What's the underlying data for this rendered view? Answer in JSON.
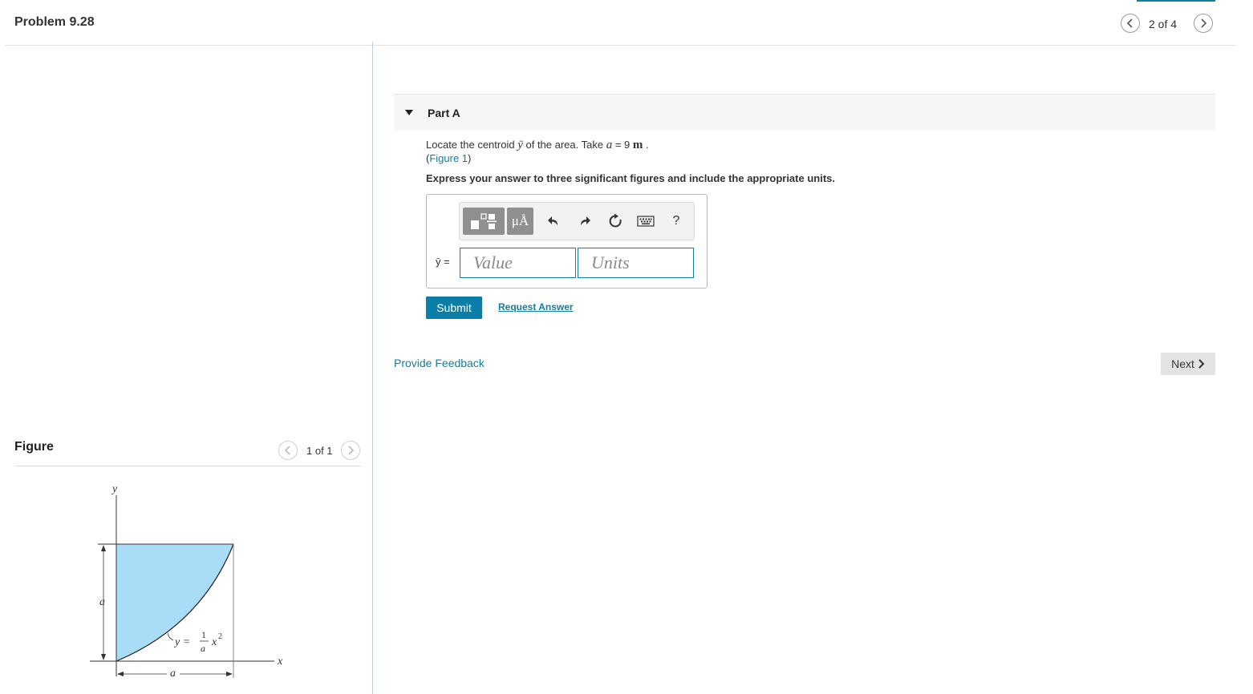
{
  "header": {
    "title": "Problem 9.28",
    "pager_text": "2 of 4"
  },
  "figure_panel": {
    "title": "Figure",
    "pager_text": "1 of 1",
    "labels": {
      "y_axis": "y",
      "x_axis": "x",
      "height": "a",
      "width": "a",
      "curve_lhs": "y =",
      "curve_num": "1",
      "curve_den": "a",
      "curve_x": "x",
      "curve_exp": "2"
    },
    "fill_color": "#a9dcf7"
  },
  "part": {
    "label": "Part A",
    "prompt_pre": "Locate the centroid ",
    "prompt_var": "ȳ",
    "prompt_mid": " of the area. Take ",
    "prompt_a": "a",
    "prompt_eq": " = 9 ",
    "prompt_unit": "m",
    "prompt_end": " .",
    "figure_open": "(",
    "figure_link": "Figure 1",
    "figure_close": ")",
    "instruction": "Express your answer to three significant figures and include the appropriate units."
  },
  "answer": {
    "var_label": "ȳ =",
    "value_placeholder": "Value",
    "units_placeholder": "Units",
    "toolbar": {
      "units_label": "μÅ",
      "help_label": "?"
    }
  },
  "actions": {
    "submit_label": "Submit",
    "request_label": "Request Answer",
    "feedback_label": "Provide Feedback",
    "next_label": "Next"
  },
  "colors": {
    "accent": "#117ea3",
    "submit": "#0b7ea8",
    "toolbar_button": "#8f8f8f"
  }
}
